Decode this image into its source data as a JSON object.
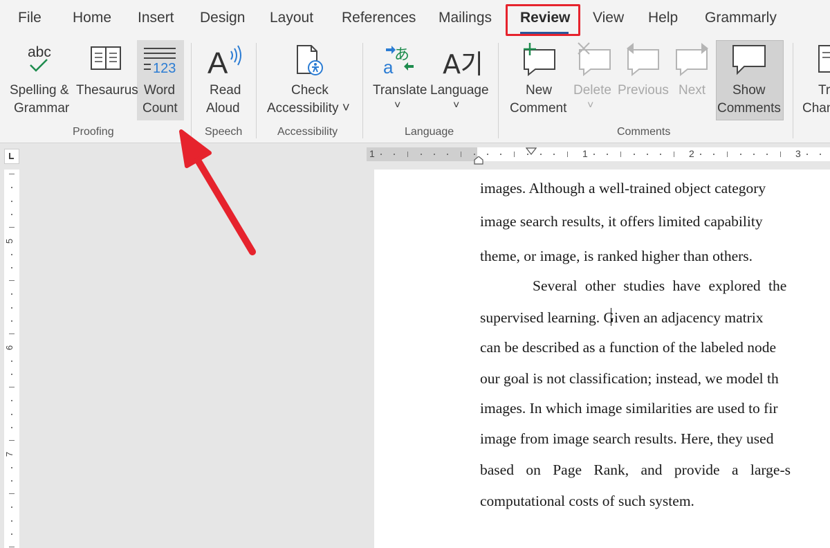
{
  "menu": {
    "tabs": [
      "File",
      "Home",
      "Insert",
      "Design",
      "Layout",
      "References",
      "Mailings",
      "Review",
      "View",
      "Help",
      "Grammarly"
    ],
    "active": "Review"
  },
  "ribbon": {
    "spelling": {
      "line1": "Spelling &",
      "line2": "Grammar",
      "icon_text": "abc",
      "icon": "spelling-check-icon"
    },
    "thesaurus": {
      "label": "Thesaurus",
      "icon": "book-icon"
    },
    "word_count": {
      "line1": "Word",
      "line2": "Count",
      "icon_text": "123",
      "icon": "word-count-icon"
    },
    "read_aloud": {
      "line1": "Read",
      "line2": "Aloud",
      "icon_text": "A",
      "icon": "read-aloud-icon"
    },
    "check_accessibility": {
      "line1": "Check",
      "line2": "Accessibility ˅",
      "icon": "accessibility-icon"
    },
    "translate": {
      "label": "Translate",
      "caret": "˅",
      "icon_text_a": "あ",
      "icon_text_b": "a",
      "icon": "translate-icon"
    },
    "language": {
      "label": "Language",
      "caret": "˅",
      "icon_text": "A가",
      "icon": "language-icon"
    },
    "new_comment": {
      "line1": "New",
      "line2": "Comment",
      "icon": "new-comment-icon"
    },
    "delete": {
      "label": "Delete",
      "caret": "˅",
      "icon": "delete-comment-icon"
    },
    "previous": {
      "label": "Previous",
      "icon": "previous-comment-icon"
    },
    "next": {
      "label": "Next",
      "icon": "next-comment-icon"
    },
    "show_comments": {
      "line1": "Show",
      "line2": "Comments",
      "icon": "show-comments-icon"
    },
    "track_changes": {
      "line1": "Tr",
      "line2": "Chan",
      "icon": "track-changes-icon"
    },
    "groups": {
      "proofing": "Proofing",
      "speech": "Speech",
      "accessibility": "Accessibility",
      "language": "Language",
      "comments": "Comments"
    }
  },
  "ruler": {
    "h_numbers": [
      "1",
      "1",
      "2",
      "3"
    ],
    "v_numbers": [
      "5",
      "6",
      "7"
    ]
  },
  "document": {
    "lines": [
      "images. Although a well-trained object category",
      "image search results, it offers limited capability",
      "theme, or image, is ranked higher than others.",
      "Several other studies have explored the",
      "supervised learning. Given an adjacency matrix",
      "can be described as a function of the labeled node",
      "our goal is not classification; instead, we model th",
      "images. In which image similarities are used to fir",
      "image from image search results. Here, they used",
      "based on Page Rank, and provide a large-s",
      "computational costs of such system."
    ]
  },
  "colors": {
    "accent": "#2b579a",
    "highlight": "#e6232d",
    "arrow": "#e6232d",
    "icon_blue": "#2b7cd3",
    "icon_green": "#1e8c4e"
  }
}
